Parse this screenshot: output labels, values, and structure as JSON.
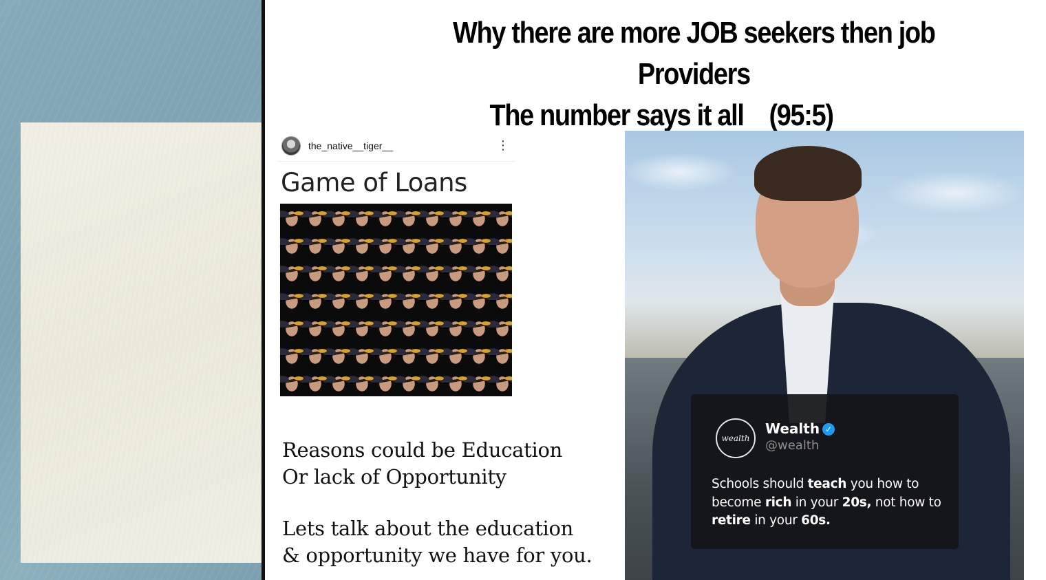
{
  "title": {
    "line1": "Why there are more JOB seekers then job Providers",
    "line2": "The number says it all    (95:5)"
  },
  "post": {
    "username": "the_native__tiger__",
    "more_icon": "⋮",
    "heading": "Game of Loans"
  },
  "reasons": {
    "line1": "Reasons could be Education",
    "line2": "Or lack of Opportunity",
    "line3": "Lets talk about the education",
    "line4": "& opportunity we have for you."
  },
  "tweet": {
    "avatar_text": "wealth",
    "name": "Wealth",
    "verified_icon": "✓",
    "handle": "@wealth",
    "text": {
      "p1": "Schools should ",
      "b1": "teach",
      "p2": " you how to become ",
      "b2": "rich",
      "p3": " in your ",
      "b3": "20s,",
      "p4": " not how to ",
      "b4": "retire",
      "p5": " in your ",
      "b5": "60s."
    }
  },
  "colors": {
    "left_panel": "#86aab8",
    "paper": "#f1efe4",
    "divider": "#111111",
    "tweet_bg": "#14161a",
    "verified": "#1d9bf0"
  }
}
